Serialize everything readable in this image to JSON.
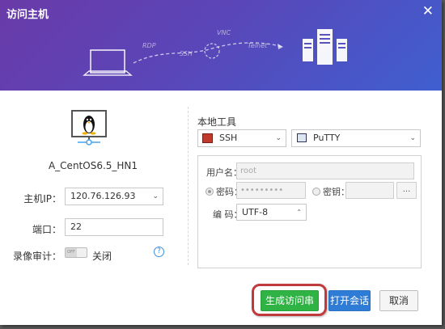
{
  "window": {
    "title": "访问主机",
    "close_icon": "close-icon"
  },
  "header": {
    "labels": [
      "RDP",
      "VNC",
      "SSH",
      "Telnet"
    ],
    "gradient": [
      "#6a3aa8",
      "#3f5fd0"
    ]
  },
  "host": {
    "name": "A_CentOS6.5_HN1",
    "icon": "linux-monitor-icon"
  },
  "form": {
    "ip_label": "主机IP：",
    "ip_value": "120.76.126.93",
    "port_label": "端口：",
    "port_value": "22",
    "record_label": "录像审计：",
    "toggle_text": "OFF",
    "record_state": "关闭",
    "help_text": "?"
  },
  "tools": {
    "section_title": "本地工具",
    "protocol": "SSH",
    "client": "PuTTY",
    "username_label": "用户名：",
    "username_placeholder": "root",
    "password_label": "密码：",
    "password_value": "•••••••••",
    "key_label": "密钥：",
    "key_browse": "...",
    "encoding_label": "编 码：",
    "encoding_value": "UTF-8"
  },
  "buttons": {
    "generate": "生成访问串",
    "open_session": "打开会话",
    "cancel": "取消"
  },
  "colors": {
    "accent_green": "#2fb344",
    "accent_blue": "#2e7cd6",
    "highlight": "#c0393b"
  }
}
